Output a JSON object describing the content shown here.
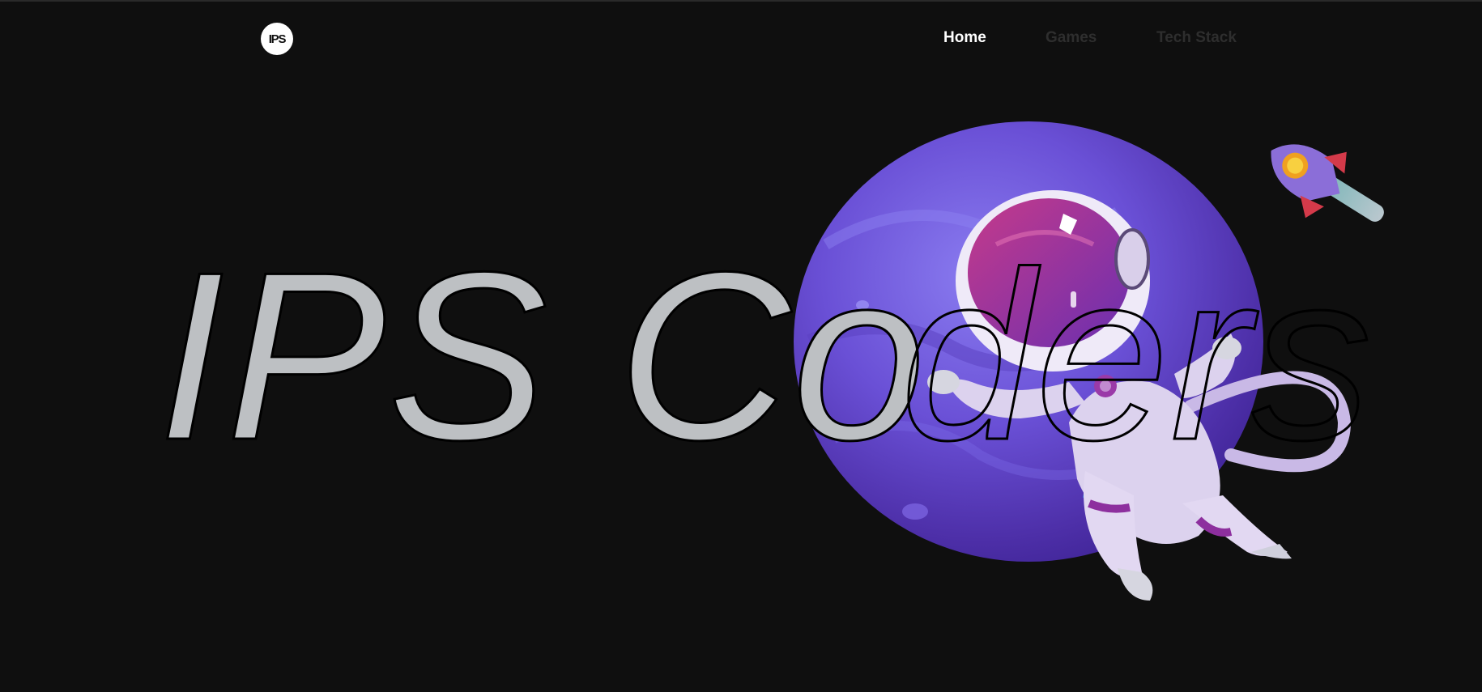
{
  "header": {
    "logo_text": "IPS",
    "nav": [
      {
        "label": "Home",
        "active": true
      },
      {
        "label": "Games",
        "active": false
      },
      {
        "label": "Tech Stack",
        "active": false
      }
    ]
  },
  "hero": {
    "title_part1": "IPS Co",
    "title_part2": "ders"
  },
  "colors": {
    "background": "#0f0f0f",
    "title_fill": "#bdc0c3",
    "nav_active": "#ffffff",
    "nav_inactive": "#2e2e2e",
    "planet": "#6a4fd0"
  }
}
